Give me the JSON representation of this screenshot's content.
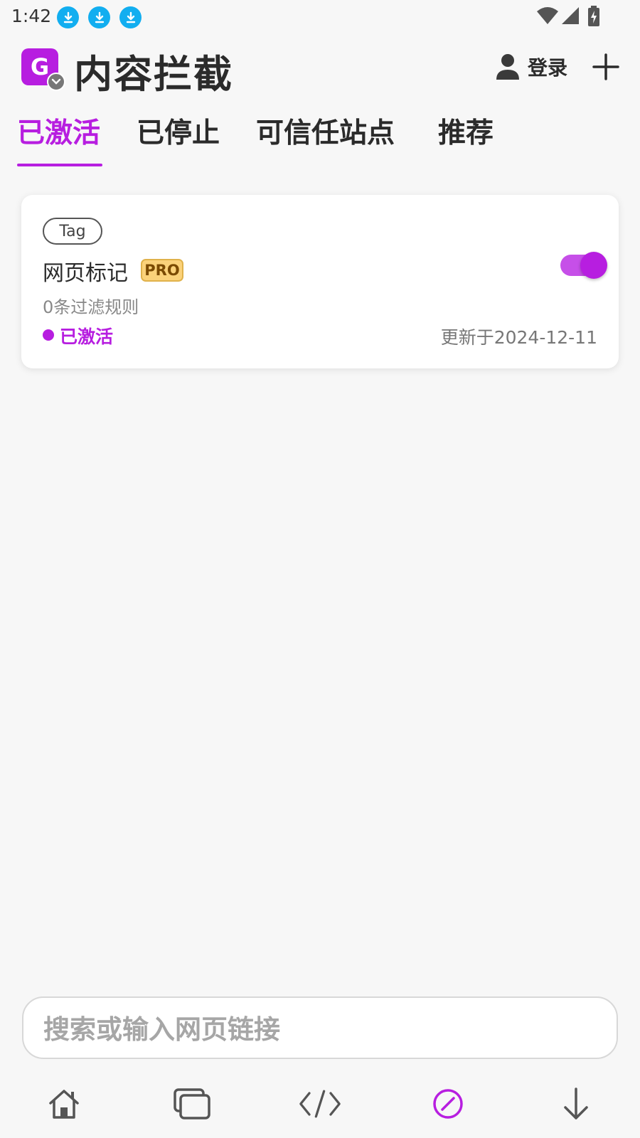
{
  "status_bar": {
    "time": "1:42",
    "icons": [
      "download-icon",
      "download-icon",
      "download-icon",
      "wifi-icon",
      "cell-signal-icon",
      "battery-charging-icon"
    ]
  },
  "header": {
    "logo_letter": "G",
    "title": "内容拦截",
    "login_label": "登录"
  },
  "tabs": [
    {
      "label": "已激活",
      "active": true
    },
    {
      "label": "已停止",
      "active": false
    },
    {
      "label": "可信任站点",
      "active": false
    },
    {
      "label": "推荐",
      "active": false
    }
  ],
  "card": {
    "tag": "Tag",
    "title": "网页标记",
    "badge": "PRO",
    "rule_count": "0条过滤规则",
    "status": "已激活",
    "updated": "更新于2024-12-11",
    "enabled": true
  },
  "search": {
    "placeholder": "搜索或输入网页链接"
  },
  "bottom_nav": [
    {
      "icon": "home-icon"
    },
    {
      "icon": "tabs-icon"
    },
    {
      "icon": "code-icon"
    },
    {
      "icon": "block-icon",
      "active": true
    },
    {
      "icon": "download-arrow-icon"
    }
  ],
  "colors": {
    "accent": "#b71ee0",
    "download_blue": "#12aef0",
    "pro_badge": "#fbd27a",
    "background": "#f7f7f7"
  }
}
